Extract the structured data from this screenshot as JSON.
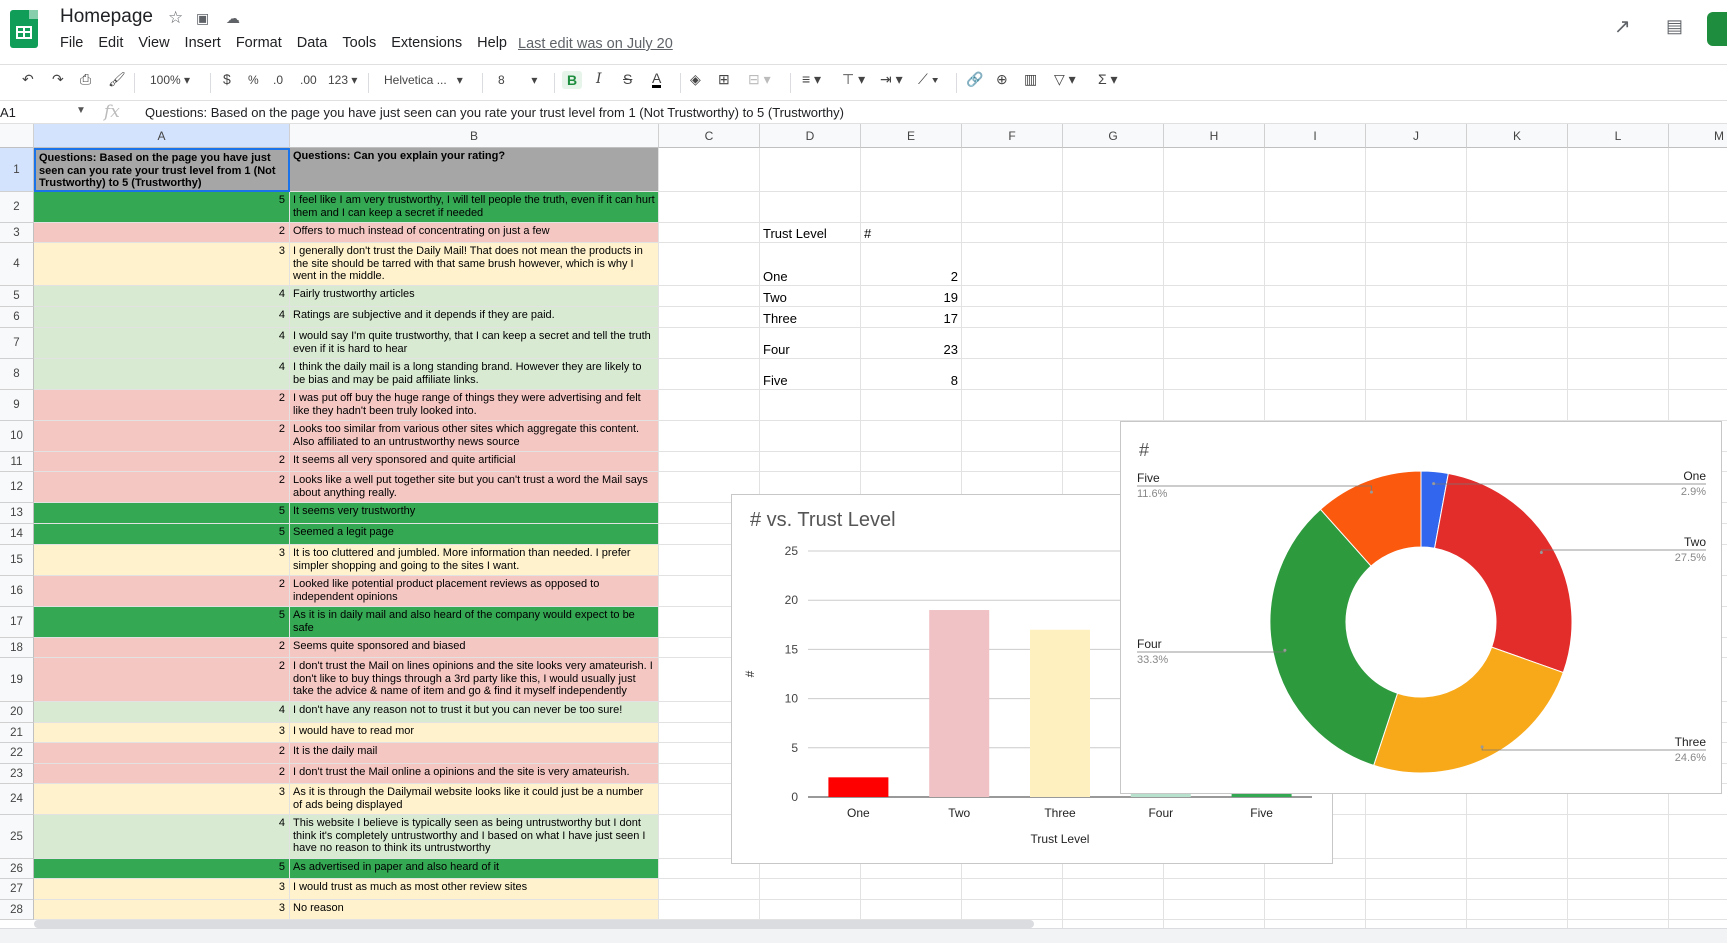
{
  "app": {
    "doc_title": "Homepage",
    "menu": [
      "File",
      "Edit",
      "View",
      "Insert",
      "Format",
      "Data",
      "Tools",
      "Extensions",
      "Help"
    ],
    "last_edit": "Last edit was on July 20"
  },
  "toolbar": {
    "zoom": "100%",
    "currency": "$",
    "percent": "%",
    "dec_less": ".0",
    "dec_more": ".00",
    "number_format": "123",
    "font": "Helvetica ...",
    "font_size": "8",
    "bold": "B",
    "italic": "I",
    "strike": "S",
    "text_color": "A"
  },
  "formula_bar": {
    "cell_ref": "A1",
    "fx": "fx",
    "content": "Questions: Based on the page you have just seen can you rate your trust level from 1 (Not Trustworthy) to 5 (Trustworthy)"
  },
  "columns": [
    "A",
    "B",
    "C",
    "D",
    "E",
    "F",
    "G",
    "H",
    "I",
    "J",
    "K",
    "L",
    "M"
  ],
  "header_row": {
    "a": "Questions: Based on the page you have just seen can you rate your trust level from 1 (Not Trustworthy) to 5 (Trustworthy)",
    "b": "Questions: Can you explain your rating?"
  },
  "rows": [
    {
      "n": "2",
      "rating": "5",
      "text": "I feel like I am very trustworthy, I will tell people the truth, even if it can hurt them and I can keep a secret if needed"
    },
    {
      "n": "3",
      "rating": "2",
      "text": "Offers to much instead of concentrating on just a few"
    },
    {
      "n": "4",
      "rating": "3",
      "text": "I generally don't trust the Daily Mail! That does not mean the products in the site should be tarred with that same brush however, which is why I went in the middle."
    },
    {
      "n": "5",
      "rating": "4",
      "text": "Fairly trustworthy articles"
    },
    {
      "n": "6",
      "rating": "4",
      "text": "Ratings are subjective and it depends if they are paid."
    },
    {
      "n": "7",
      "rating": "4",
      "text": "I would say I'm quite trustworthy, that I can keep a secret and tell the truth even if it is hard to hear"
    },
    {
      "n": "8",
      "rating": "4",
      "text": "I think the daily mail is a long standing brand. However they are likely to be bias and may be paid affiliate links."
    },
    {
      "n": "9",
      "rating": "2",
      "text": "I was put off buy the huge range of things they were advertising and felt like they hadn't been truly looked into."
    },
    {
      "n": "10",
      "rating": "2",
      "text": "Looks too similar from various other sites which aggregate this content. Also affiliated to an untrustworthy news source"
    },
    {
      "n": "11",
      "rating": "2",
      "text": "It seems all very sponsored and quite artificial"
    },
    {
      "n": "12",
      "rating": "2",
      "text": "Looks like a well put together site but you can't trust a word the Mail says about anything really."
    },
    {
      "n": "13",
      "rating": "5",
      "text": "It seems very trustworthy"
    },
    {
      "n": "14",
      "rating": "5",
      "text": "Seemed a legit page"
    },
    {
      "n": "15",
      "rating": "3",
      "text": "It is too cluttered and jumbled. More information than needed. I prefer simpler shopping and going to the sites I want."
    },
    {
      "n": "16",
      "rating": "2",
      "text": "Looked like potential product placement reviews as opposed to independent opinions"
    },
    {
      "n": "17",
      "rating": "5",
      "text": "As it is in daily mail and also heard of the company would expect to be safe"
    },
    {
      "n": "18",
      "rating": "2",
      "text": "Seems quite sponsored and biased"
    },
    {
      "n": "19",
      "rating": "2",
      "text": "I don't trust the Mail on lines opinions and the site looks very amateurish. I don't like to buy things through a 3rd party like this, I would usually just take the advice & name of item and go & find it myself independently"
    },
    {
      "n": "20",
      "rating": "4",
      "text": "I don't have any reason not to trust it but you can never be too sure!"
    },
    {
      "n": "21",
      "rating": "3",
      "text": "I would have to read mor"
    },
    {
      "n": "22",
      "rating": "2",
      "text": "It is the daily mail"
    },
    {
      "n": "23",
      "rating": "2",
      "text": "I don't trust the Mail online a opinions and the site is very amateurish."
    },
    {
      "n": "24",
      "rating": "3",
      "text": "As it is through the Dailymail website looks like it could just be a number of ads being displayed"
    },
    {
      "n": "25",
      "rating": "4",
      "text": "This website I believe is typically seen as being untrustworthy but I dont think it's completely untrustworthy  and I based on what I have just seen I have no reason to think its untrustworthy"
    },
    {
      "n": "26",
      "rating": "5",
      "text": "As advertised in paper and also heard of it"
    },
    {
      "n": "27",
      "rating": "3",
      "text": "I would trust as much as most other review sites"
    },
    {
      "n": "28",
      "rating": "3",
      "text": "No reason"
    }
  ],
  "summary": {
    "header_level": "Trust Level",
    "header_count": "#",
    "items": [
      {
        "label": "One",
        "value": "2"
      },
      {
        "label": "Two",
        "value": "19"
      },
      {
        "label": "Three",
        "value": "17"
      },
      {
        "label": "Four",
        "value": "23"
      },
      {
        "label": "Five",
        "value": "8"
      }
    ]
  },
  "rating_colors": {
    "2": "#f4c7c3",
    "3": "#fff2cc",
    "4": "#d9ead3",
    "5": "#34a853"
  },
  "chart_data": [
    {
      "type": "bar",
      "title": "# vs. Trust Level",
      "xlabel": "Trust Level",
      "ylabel": "#",
      "categories": [
        "One",
        "Two",
        "Three",
        "Four",
        "Five"
      ],
      "values": [
        2,
        19,
        17,
        23,
        8
      ],
      "colors": [
        "#ff0000",
        "#f0c1c5",
        "#fff0c0",
        "#b7e1cd",
        "#34a853"
      ],
      "ylim": [
        0,
        25
      ],
      "yticks": [
        "0",
        "5",
        "10",
        "15",
        "20",
        "25"
      ],
      "grid": true
    },
    {
      "type": "pie",
      "donut": true,
      "title": "#",
      "labels": [
        "One",
        "Two",
        "Three",
        "Four",
        "Five"
      ],
      "values": [
        2,
        19,
        17,
        23,
        8
      ],
      "percents": [
        "2.9%",
        "27.5%",
        "24.6%",
        "33.3%",
        "11.6%"
      ],
      "colors": [
        "#3366ee",
        "#e22d2a",
        "#f8a91a",
        "#2e9a3e",
        "#fb5a0e"
      ]
    }
  ]
}
